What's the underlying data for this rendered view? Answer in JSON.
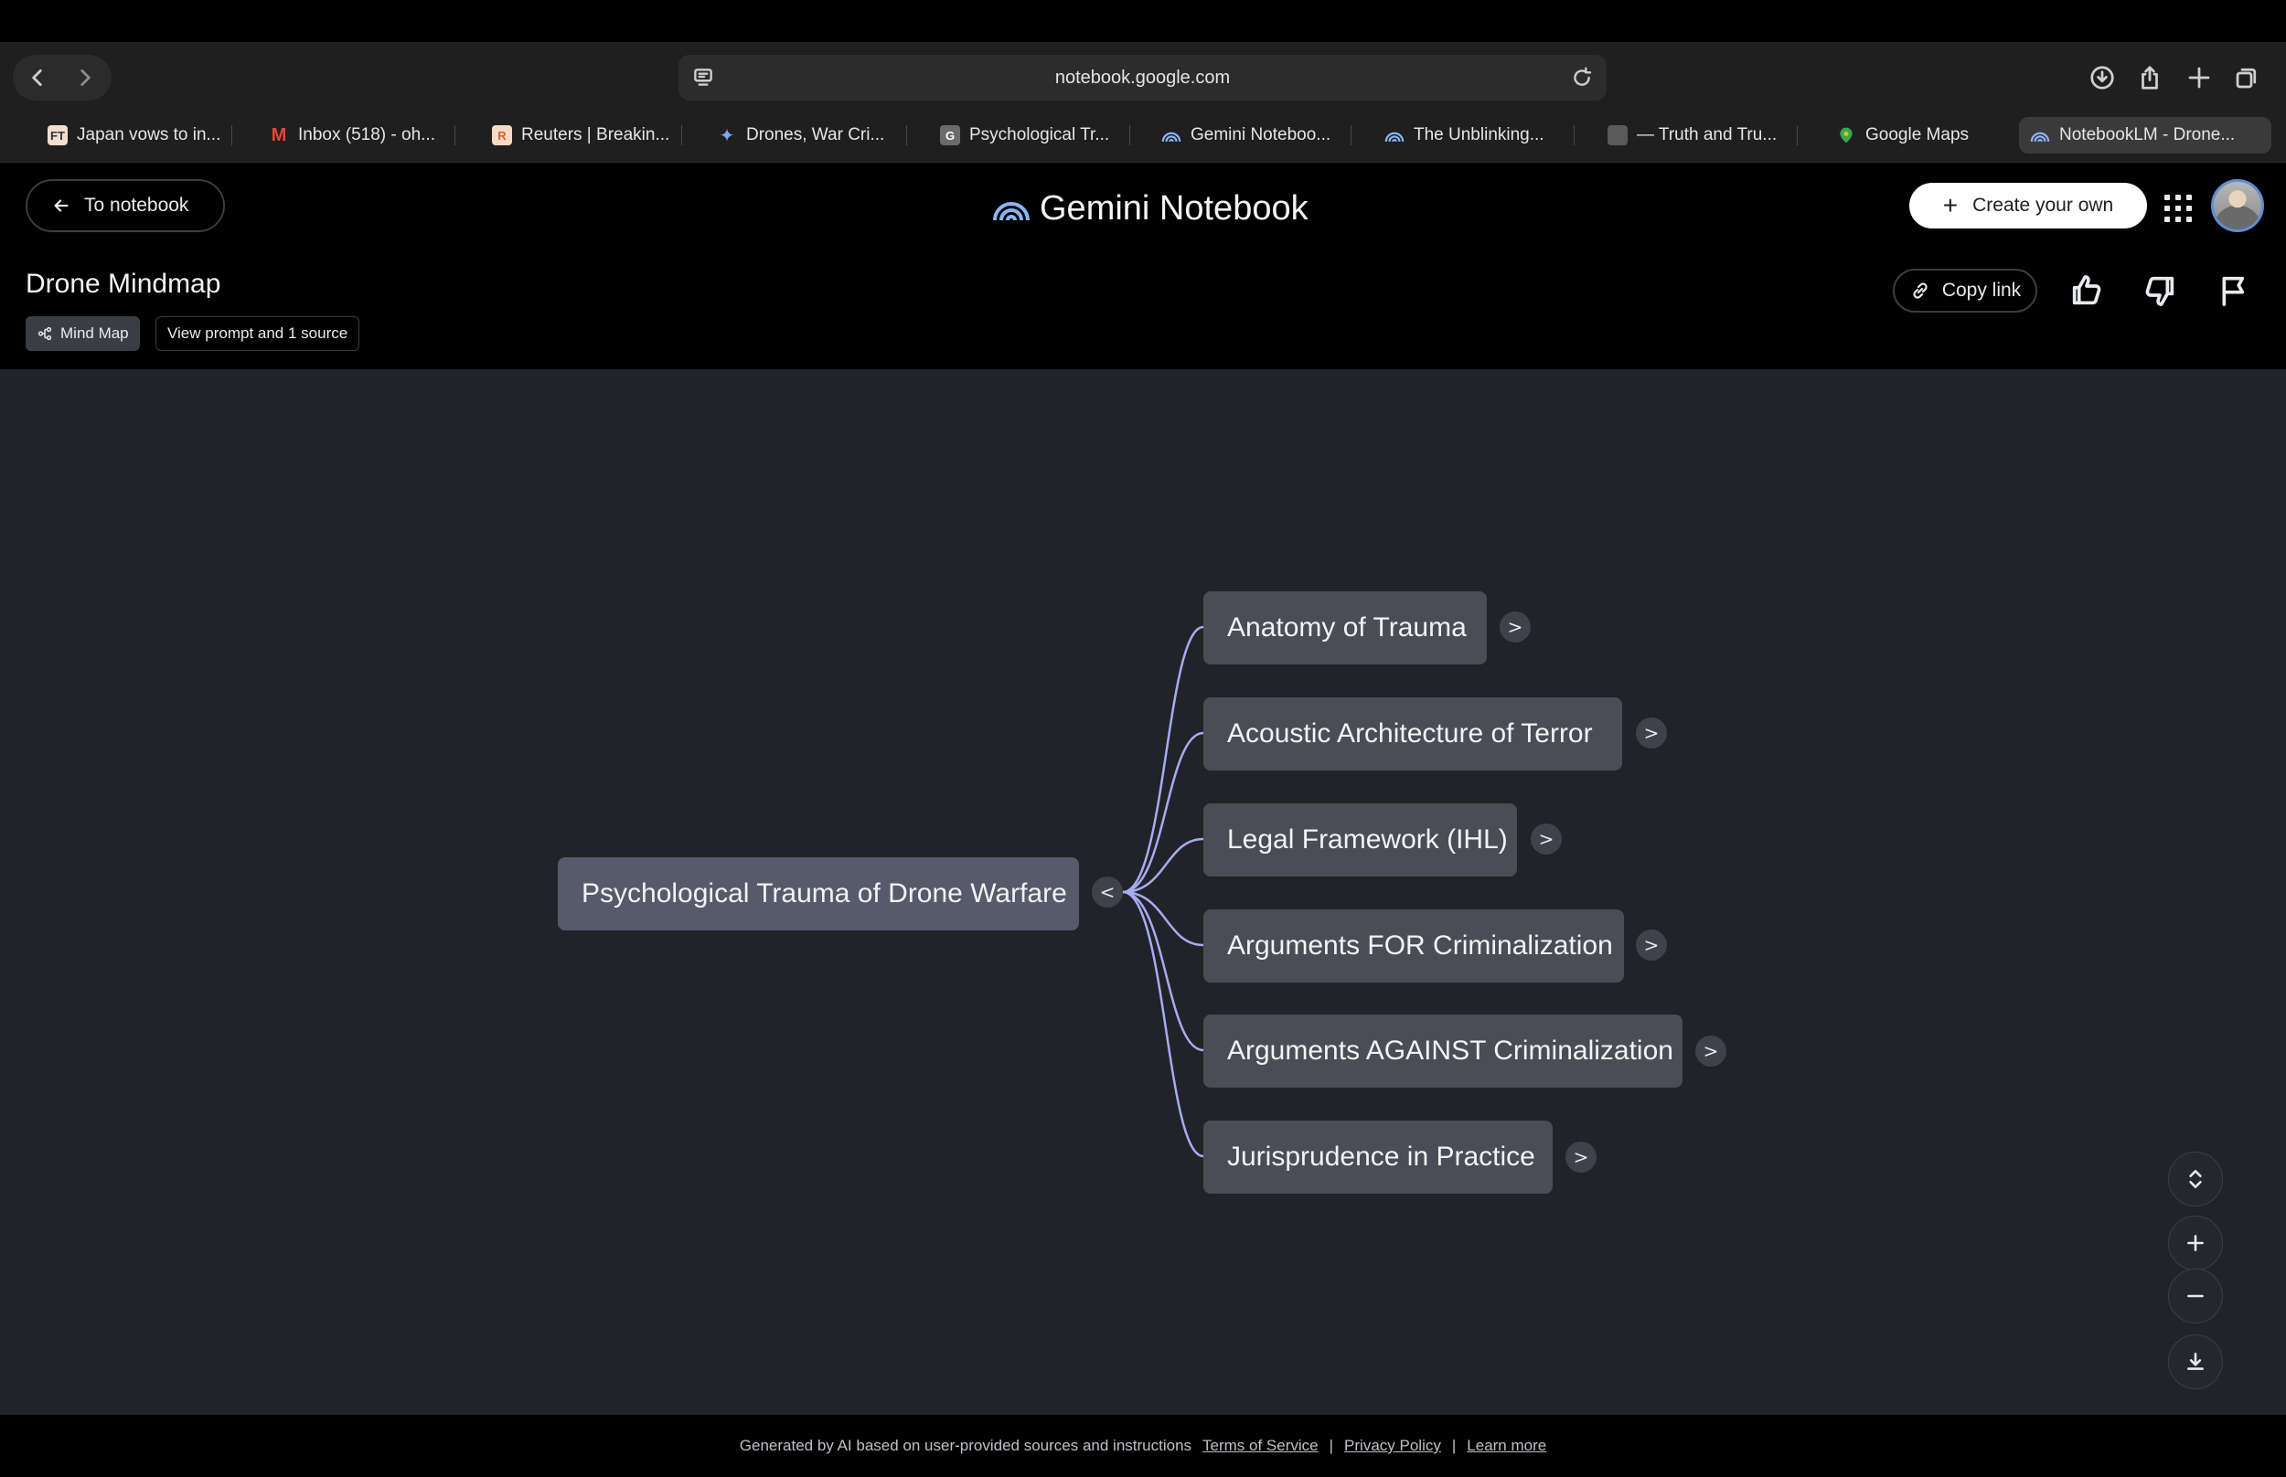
{
  "browser": {
    "url": "notebook.google.com",
    "tabs": [
      {
        "label": "Japan vows to in...",
        "favicon": "FT",
        "favicon_bg": "#f2dfce",
        "favicon_fg": "#33302e"
      },
      {
        "label": "Inbox (518) - oh...",
        "favicon": "M",
        "favicon_bg": "transparent",
        "favicon_fg": "#ea4335"
      },
      {
        "label": "Reuters | Breakin...",
        "favicon": "R",
        "favicon_bg": "#f7d9c4",
        "favicon_fg": "#d9622b"
      },
      {
        "label": "Drones, War Cri...",
        "favicon": "✦",
        "favicon_bg": "transparent",
        "favicon_fg": "#7fa6f5"
      },
      {
        "label": "Psychological Tr...",
        "favicon": "G",
        "favicon_bg": "#6b6b6b",
        "favicon_fg": "#ffffff"
      },
      {
        "label": "Gemini Noteboo...",
        "favicon": "notebook-arc",
        "favicon_bg": "transparent",
        "favicon_fg": "#8ab4f8"
      },
      {
        "label": "The Unblinking...",
        "favicon": "notebook-arc",
        "favicon_bg": "transparent",
        "favicon_fg": "#8ab4f8"
      },
      {
        "label": "— Truth and Tru...",
        "favicon": "cube",
        "favicon_bg": "#5a5a5a",
        "favicon_fg": "#cccccc"
      },
      {
        "label": "Google Maps",
        "favicon": "map-pin",
        "favicon_bg": "transparent",
        "favicon_fg": "#34a853"
      },
      {
        "label": "NotebookLM - Drone...",
        "favicon": "notebook-arc",
        "favicon_bg": "transparent",
        "favicon_fg": "#8ab4f8"
      }
    ]
  },
  "header": {
    "back_label": "To notebook",
    "brand": "Gemini Notebook",
    "create_label": "Create your own",
    "title": "Drone Mindmap",
    "chip_type": "Mind Map",
    "chip_prompt": "View prompt and 1 source",
    "copy_link": "Copy link"
  },
  "mindmap": {
    "root": "Psychological Trauma of Drone Warfare",
    "root_toggle": "<",
    "child_toggle": ">",
    "children": [
      "Anatomy of Trauma",
      "Acoustic Architecture of Terror",
      "Legal Framework (IHL)",
      "Arguments FOR Criminalization",
      "Arguments AGAINST Criminalization",
      "Jurisprudence in Practice"
    ],
    "link_color": "#a8abf2"
  },
  "footer": {
    "text": "Generated by AI based on user-provided sources and instructions",
    "terms": "Terms of Service",
    "privacy": "Privacy Policy",
    "learn": "Learn more",
    "separator": "|"
  },
  "colors": {
    "canvas_bg": "#212328",
    "node_bg": "#4a4d55",
    "root_bg": "#575a6a",
    "brand_arc": "#8ab4f8"
  }
}
